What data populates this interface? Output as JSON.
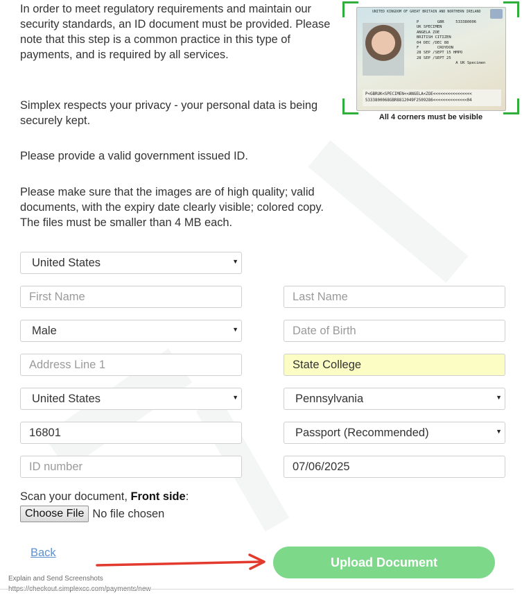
{
  "intro": {
    "paragraph1": "In order to meet regulatory requirements and maintain our security standards, an ID document must be provided. Please note that this step is a common practice in this type of payments, and is required by all services.",
    "paragraph2": "Simplex respects your privacy - your personal data is being securely kept.",
    "paragraph3": "Please provide a valid government issued ID.",
    "paragraph4": "Please make sure that the images are of high quality; valid documents, with the expiry date clearly visible; colored copy. The files must be smaller than 4 MB each."
  },
  "sample_image": {
    "caption": "All 4 corners must be visible",
    "header_text": "UNITED KINGDOM OF GREAT BRITAIN AND NORTHERN IRELAND",
    "fields_text": "P        GBR     533380006\nUK SPECIMEN\nANGELA ZOE\nBRITISH CITIZEN\n04 DEC /DEC 88\nF        CROYDON\n28 SEP /SEPT 15 HMPO\n28 SEP /SEPT 25\n                 A UK Specimen",
    "mrz_text": "P<GBRUK<SPECIMEN<<ANGELA<ZOE<<<<<<<<<<<<<<<<\n5333800068GBR8812049F2509286<<<<<<<<<<<<<<04"
  },
  "form": {
    "issuing_country": "United States",
    "first_name_placeholder": "First Name",
    "last_name_placeholder": "Last Name",
    "gender": "Male",
    "dob_placeholder": "Date of Birth",
    "address_placeholder": "Address Line 1",
    "city": "State College",
    "country": "United States",
    "state": "Pennsylvania",
    "zip": "16801",
    "document_type": "Passport (Recommended)",
    "id_number_placeholder": "ID number",
    "expiry_date": "07/06/2025"
  },
  "upload": {
    "scan_label_prefix": "Scan your document, ",
    "scan_label_bold": "Front side",
    "scan_label_suffix": ":",
    "choose_file": "Choose File",
    "file_status": "No file chosen"
  },
  "actions": {
    "back": "Back",
    "upload_document": "Upload Document"
  },
  "footer": {
    "line1": "Explain and Send Screenshots",
    "line2": "https://checkout.simplexcc.com/payments/new"
  },
  "colors": {
    "accent_green": "#7ed88a",
    "corner_green": "#2fae3c",
    "link_blue": "#5d8fcf",
    "autofill_yellow": "#fbfdc4",
    "arrow_red": "#e23b2e"
  }
}
